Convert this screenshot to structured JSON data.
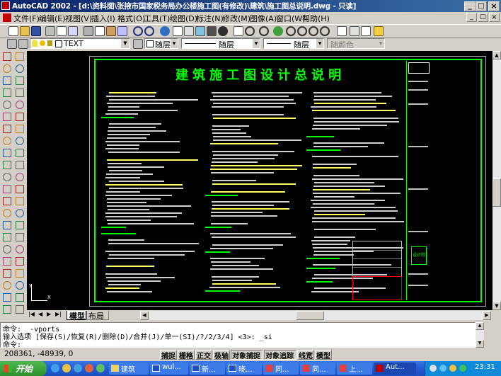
{
  "title_bar": {
    "text": "AutoCAD 2002 - [d:\\资料图\\张掖市国家税务局办公楼施工图(有修改)\\建筑\\施工图总说明.dwg - 只读]",
    "buttons": [
      "_",
      "□",
      "×"
    ]
  },
  "menu": {
    "items": [
      "文件(F)",
      "编辑(E)",
      "视图(V)",
      "插入(I)",
      "格式(O)",
      "工具(T)",
      "绘图(D)",
      "标注(N)",
      "修改(M)",
      "图像(A)",
      "窗口(W)",
      "帮助(H)"
    ],
    "doc_buttons": [
      "_",
      "□",
      "×"
    ]
  },
  "properties_bar": {
    "layer": "TEXT",
    "color": "随层",
    "linetype": "随层",
    "lineweight": "随层",
    "plotstyle": "随颜色"
  },
  "drawing": {
    "title": "建筑施工图设计总说明",
    "background": "#000000",
    "frame_color": "#00ff00",
    "title_color": "#00ff00",
    "text_color": "#d8d8d8",
    "heading_color": "#00ff00",
    "logo_label": "设计院"
  },
  "tabs": {
    "items": [
      "模型",
      "布局1"
    ],
    "active": "模型"
  },
  "command": {
    "lines": [
      "命令: _-vports",
      "输入选项 [保存(S)/恢复(R)/删除(D)/合并(J)/单一(SI)/?/2/3/4] <3>: _si",
      "命令:"
    ]
  },
  "status": {
    "coords": "208361, -48939, 0",
    "toggles": [
      "捕捉",
      "栅格",
      "正交",
      "极轴",
      "对象捕捉",
      "对象追踪",
      "线宽",
      "模型"
    ]
  },
  "taskbar": {
    "start": "开始",
    "items": [
      "建筑",
      "wul...",
      "新...",
      "晓...",
      "同...",
      "同...",
      "上...",
      "Aut..."
    ],
    "time": "23:31"
  },
  "colors": {
    "titlebar": "#0a246a",
    "taskbar": "#245edb",
    "start": "#3c9f3c"
  }
}
